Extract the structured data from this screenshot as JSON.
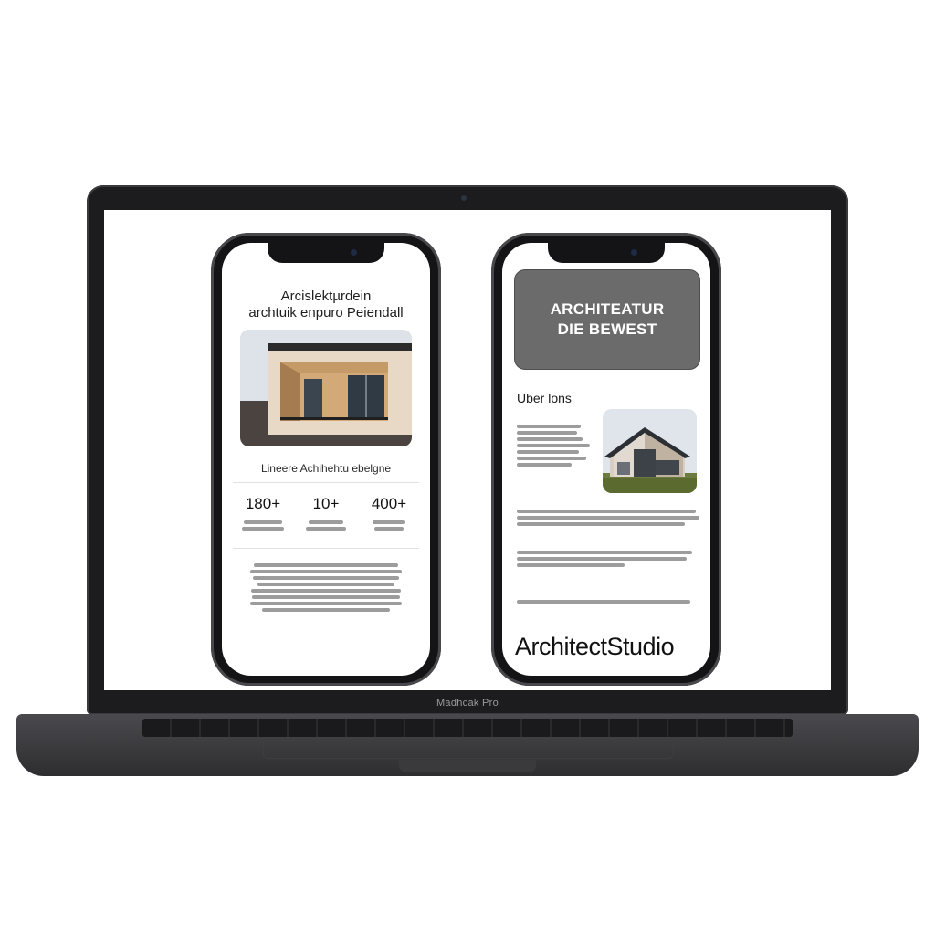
{
  "device": {
    "model_label": "Madhcak Pro"
  },
  "left_phone": {
    "title_line1": "Arcislektµrdein",
    "title_line2": "archtuik enpuro Peiendall",
    "subtitle": "Lineere Achihehtu ebelgne",
    "stats": [
      {
        "value": "180+"
      },
      {
        "value": "10+"
      },
      {
        "value": "400+"
      }
    ]
  },
  "right_phone": {
    "banner_line1": "ARCHITEATUR",
    "banner_line2": "DIE BEWEST",
    "heading": "Uber lons",
    "brand": "ArchitectStudio"
  },
  "colors": {
    "banner": "#6b6b6b",
    "frame": "#1c1c1e"
  }
}
